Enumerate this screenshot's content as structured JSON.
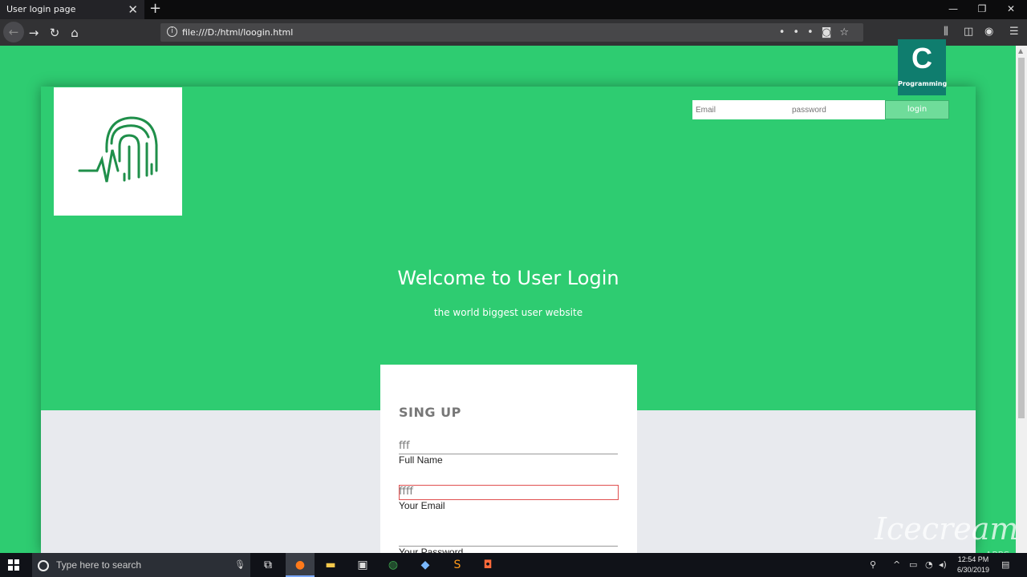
{
  "browser": {
    "tab_title": "User login page",
    "tab_close": "✕",
    "new_tab": "+",
    "url": "file:///D:/html/loogin.html",
    "window_controls": [
      "—",
      "❐",
      "✕"
    ]
  },
  "header": {
    "email_placeholder": "Email",
    "password_placeholder": "password",
    "login_label": "login"
  },
  "hero": {
    "title": "Welcome to User Login",
    "subtitle": "the world biggest user website"
  },
  "signup": {
    "title": "SING UP",
    "fields": [
      {
        "value": "fff",
        "label": "Full Name"
      },
      {
        "value": "ffff",
        "label": "Your Email"
      },
      {
        "value": "",
        "label": "Your Password"
      }
    ]
  },
  "overlay": {
    "badge_letter": "C",
    "badge_text": "Programming",
    "watermark": "Icecream",
    "watermark_sub": "APPS"
  },
  "taskbar": {
    "search_placeholder": "Type here to search",
    "time": "12:54 PM",
    "date": "6/30/2019"
  },
  "colors": {
    "brand_green": "#2ecc71",
    "card_bg": "#e8eaee",
    "error_border": "#e05050",
    "icon_green": "#1f8f4a"
  }
}
